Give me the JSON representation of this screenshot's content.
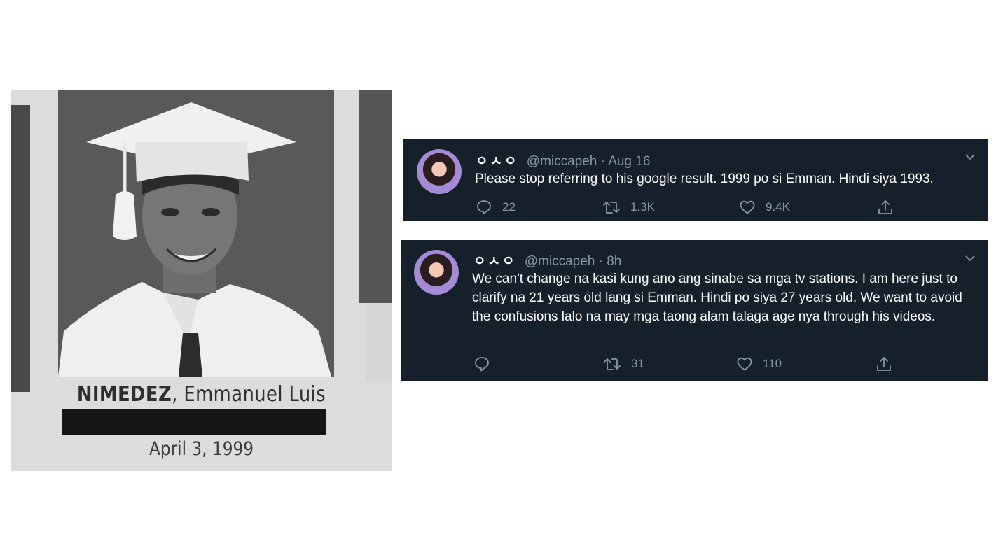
{
  "yearbook": {
    "surname": "NIMEDEZ",
    "given_names": ", Emmanuel Luis",
    "birthdate": "April 3, 1999"
  },
  "tweets": [
    {
      "display_name": "ㅇㅅㅇ",
      "handle": "@miccapeh",
      "separator": "·",
      "time": "Aug 16",
      "text": "Please stop referring to his google result. 1999 po si Emman. Hindi siya 1993.",
      "replies": "22",
      "retweets": "1.3K",
      "likes": "9.4K"
    },
    {
      "display_name": "ㅇㅅㅇ",
      "handle": "@miccapeh",
      "separator": "·",
      "time": "8h",
      "text": "We can't change na kasi kung ano ang sinabe sa mga tv stations. I am here just to clarify na 21 years old lang si Emman. Hindi po siya 27 years old. We want to avoid the confusions lalo na may mga taong alam talaga age nya through his videos.",
      "replies": "",
      "retweets": "31",
      "likes": "110"
    }
  ],
  "icons": {
    "reply": "reply-icon",
    "retweet": "retweet-icon",
    "like": "heart-icon",
    "share": "share-icon",
    "menu": "chevron-down-icon"
  },
  "colors": {
    "tweet_bg": "#15202b",
    "muted": "#8899a6"
  }
}
